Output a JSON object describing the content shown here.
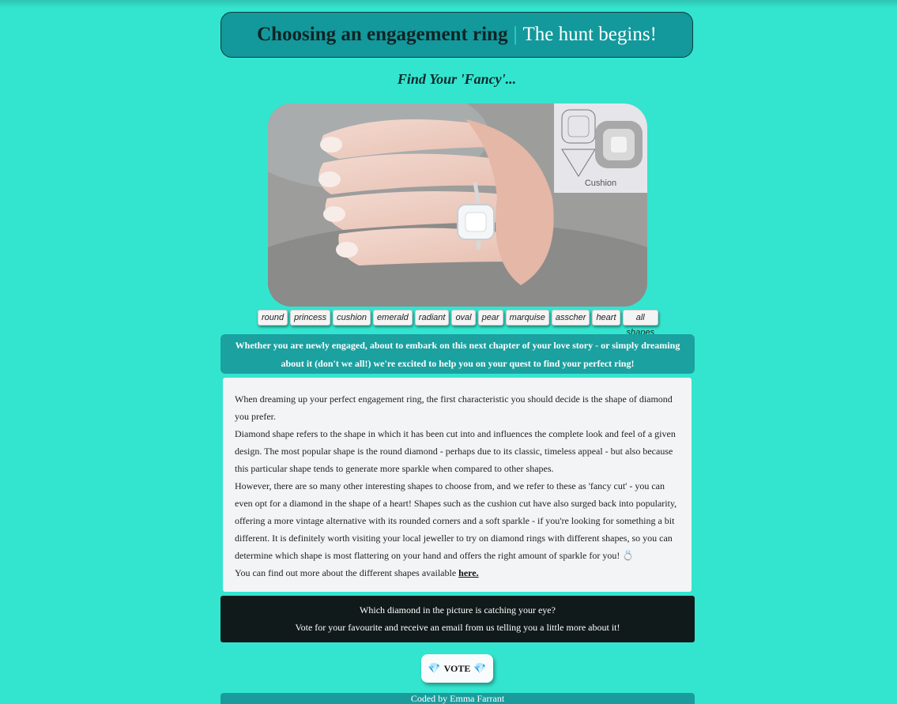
{
  "header": {
    "title_main": "Choosing an engagement ring",
    "separator": "|",
    "title_tagline": "The hunt begins!"
  },
  "subtitle": "Find Your 'Fancy'...",
  "photo": {
    "inset_caption": "Cushion"
  },
  "shapes": [
    "round",
    "princess",
    "cushion",
    "emerald",
    "radiant",
    "oval",
    "pear",
    "marquise",
    "asscher",
    "heart",
    "all shapes"
  ],
  "intro": "Whether you are newly engaged, about to embark on this next chapter of your love story - or simply dreaming about it (don't we all!) we're excited to help you on your quest to find your perfect ring!",
  "body": {
    "p1": "When dreaming up your perfect engagement ring, the first characteristic you should decide is the shape of diamond you prefer.",
    "p2": "Diamond shape refers to the shape in which it has been cut into and influences the complete look and feel of a given design. The most popular shape is the round diamond - perhaps due to its classic, timeless appeal - but also because this particular shape tends to generate more sparkle when compared to other shapes.",
    "p3": "However, there are so many other interesting shapes to choose from, and we refer to these as 'fancy cut' - you can even opt for a diamond in the shape of a heart! Shapes such as the cushion cut have also surged back into popularity, offering a more vintage alternative with its rounded corners and a soft sparkle - if you're looking for something a bit different. It is definitely worth visiting your local jeweller to try on diamond rings with different shapes, so you can determine which shape is most flattering on your hand and offers the right amount of sparkle for you! 💍",
    "p4_prefix": "You can find out more about the different shapes available",
    "p4_link": "here."
  },
  "cta": {
    "line1": "Which diamond in the picture is catching your eye?",
    "line2": "Vote for your favourite and receive an email from us telling you a little more about it!"
  },
  "vote": {
    "label": "VOTE",
    "icon": "gem-icon"
  },
  "footer": "Coded by Emma Farrant"
}
